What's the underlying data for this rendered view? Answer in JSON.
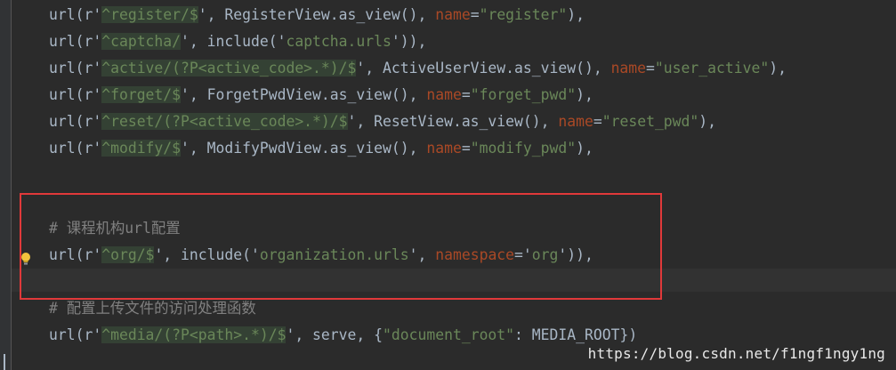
{
  "code": {
    "lines": [
      {
        "seg": [
          "url(r'",
          "^register/$",
          "', RegisterView.as_view(), ",
          "name",
          "=",
          "\"register\"",
          "),"
        ]
      },
      {
        "seg": [
          "url(r'",
          "^captcha/",
          "', include('",
          "captcha.urls",
          "')),"
        ]
      },
      {
        "seg": [
          "url(r'",
          "^active/(?P<active_code>.*)/$",
          "', ActiveUserView.as_view(), ",
          "name",
          "=",
          "\"user_active\"",
          "),"
        ]
      },
      {
        "seg": [
          "url(r'",
          "^forget/$",
          "', ForgetPwdView.as_view(), ",
          "name",
          "=",
          "\"forget_pwd\"",
          "),"
        ]
      },
      {
        "seg": [
          "url(r'",
          "^reset/(?P<active_code>.*)/$",
          "', ResetView.as_view(), ",
          "name",
          "=",
          "\"reset_pwd\"",
          "),"
        ]
      },
      {
        "seg": [
          "url(r'",
          "^modify/$",
          "', ModifyPwdView.as_view(), ",
          "name",
          "=",
          "\"modify_pwd\"",
          "),"
        ]
      },
      {
        "comment": "# 课程机构url配置"
      },
      {
        "seg": [
          "url(r'",
          "^org/$",
          "', include('",
          "organization.urls",
          "', ",
          "namespace",
          "='",
          "org",
          "')),"
        ]
      },
      {
        "comment": "# 配置上传文件的访问处理函数"
      },
      {
        "seg": [
          "url(r'",
          "^media/(?P<path>.*)/$",
          "', serve, {",
          "\"document_root\"",
          ": MEDIA_ROOT})"
        ]
      }
    ]
  },
  "watermark": "https://blog.csdn.net/f1ngf1ngy1ng",
  "colors": {
    "background": "#2b2b2b",
    "text": "#a9b7c6",
    "string": "#6a8759",
    "keyword_param": "#aa4926",
    "comment": "#808080",
    "highlight_box": "#e0393a"
  },
  "icons": {
    "bulb": "lightbulb-icon"
  }
}
